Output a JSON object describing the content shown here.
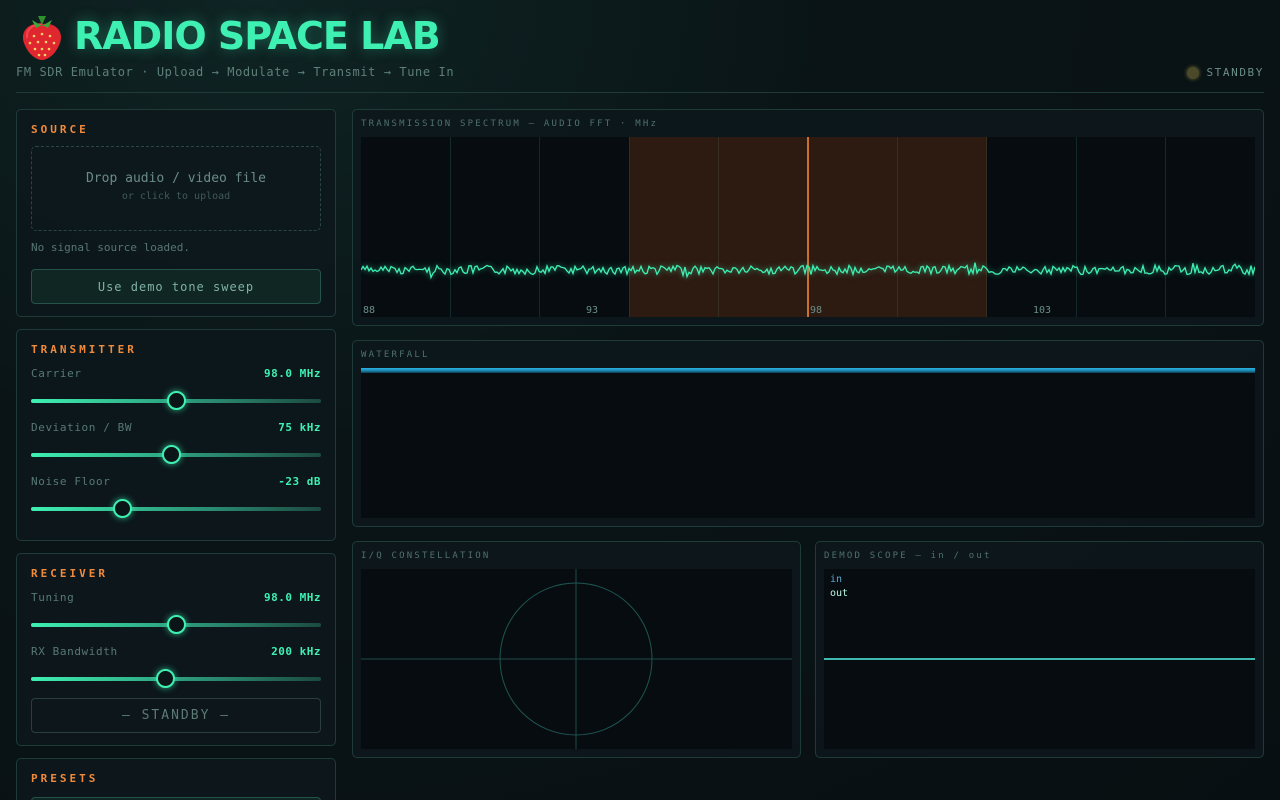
{
  "header": {
    "title": "RADIO SPACE LAB",
    "subtitle": "FM SDR Emulator · Upload → Modulate → Transmit → Tune In",
    "status": "STANDBY",
    "logo_icon": "strawberry-icon"
  },
  "source": {
    "title": "SOURCE",
    "drop_main": "Drop audio / video file",
    "drop_sub": "or click to upload",
    "status_text": "No signal source loaded.",
    "demo_button": "Use demo tone sweep"
  },
  "transmitter": {
    "title": "TRANSMITTER",
    "carrier": {
      "label": "Carrier",
      "value": "98.0 MHz",
      "level": 0.5
    },
    "deviation": {
      "label": "Deviation / BW",
      "value": "75 kHz",
      "level": 0.483
    },
    "noise": {
      "label": "Noise Floor",
      "value": "-23 dB",
      "level": 0.314
    }
  },
  "receiver": {
    "title": "RECEIVER",
    "tuning": {
      "label": "Tuning",
      "value": "98.0 MHz",
      "level": 0.5
    },
    "bandwidth": {
      "label": "RX Bandwidth",
      "value": "200 kHz",
      "level": 0.462
    },
    "standby_button": "— STANDBY —"
  },
  "presets": {
    "title": "PRESETS"
  },
  "spectrum": {
    "title": "TRANSMISSION SPECTRUM — AUDIO FFT · MHz",
    "ticks": [
      "88",
      "93",
      "98",
      "103"
    ]
  },
  "waterfall": {
    "title": "WATERFALL"
  },
  "constellation": {
    "title": "I/Q CONSTELLATION"
  },
  "scope": {
    "title": "DEMOD SCOPE — in / out",
    "legend_in": "in",
    "legend_out": "out"
  },
  "colors": {
    "accent": "#3ef0b2",
    "section_title": "#f08a3c",
    "band": "#c8702c",
    "waterfall_line": "#23a7d6"
  }
}
